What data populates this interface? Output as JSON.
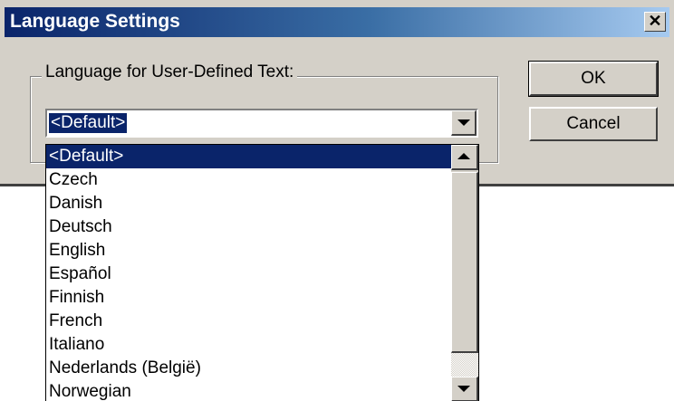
{
  "window": {
    "title": "Language Settings",
    "close_glyph": "✕"
  },
  "group": {
    "label": "Language for User-Defined Text:"
  },
  "combo": {
    "value": "<Default>"
  },
  "buttons": {
    "ok": "OK",
    "cancel": "Cancel"
  },
  "dropdown": {
    "items": [
      "<Default>",
      "Czech",
      "Danish",
      "Deutsch",
      "English",
      "Español",
      "Finnish",
      "French",
      "Italiano",
      "Nederlands (België)",
      "Norwegian"
    ],
    "selected_index": 0
  },
  "colors": {
    "selection": "#0a246a",
    "face": "#d4d0c8"
  }
}
